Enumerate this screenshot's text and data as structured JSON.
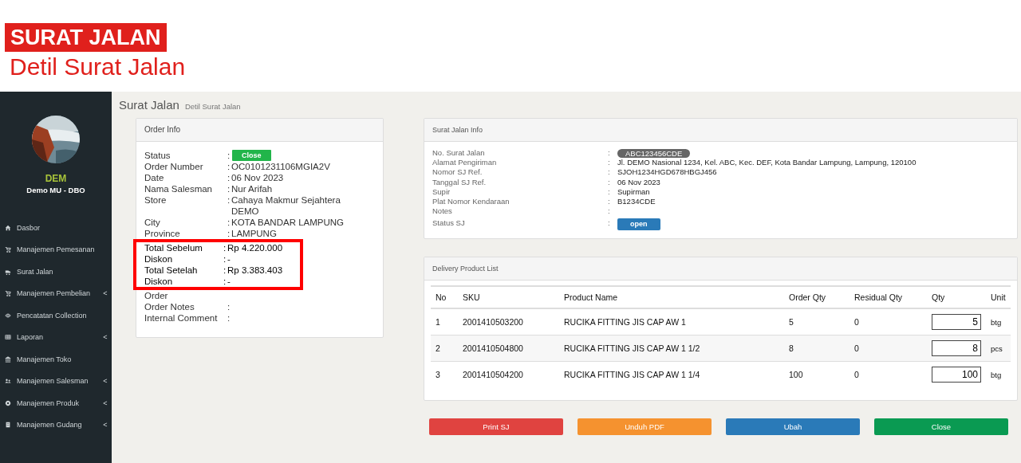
{
  "banner": {
    "title": "SURAT JALAN",
    "subtitle": "Detil Surat Jalan"
  },
  "sidebar": {
    "user": {
      "initials": "DEM",
      "name": "Demo MU - DBO"
    },
    "items": [
      {
        "label": "Dasbor",
        "kind": "home"
      },
      {
        "label": "Manajemen Pemesanan",
        "kind": "cart"
      },
      {
        "label": "Surat Jalan",
        "kind": "truck"
      },
      {
        "label": "Manajemen Pembelian",
        "kind": "cart",
        "chevron": "<"
      },
      {
        "label": "Pencatatan Collection",
        "kind": "eye"
      },
      {
        "label": "Laporan",
        "kind": "table",
        "chevron": "<"
      },
      {
        "label": "Manajemen Toko",
        "kind": "bank"
      },
      {
        "label": "Manajemen Salesman",
        "kind": "users",
        "chevron": "<"
      },
      {
        "label": "Manajemen Produk",
        "kind": "gear",
        "chevron": "<"
      },
      {
        "label": "Manajemen Gudang",
        "kind": "building",
        "chevron": "<"
      }
    ]
  },
  "page": {
    "title": "Surat Jalan",
    "subtitle": "Detil Surat Jalan"
  },
  "order_info": {
    "title": "Order Info",
    "rows": [
      {
        "label": "Status",
        "sep": ":",
        "badge": "Close"
      },
      {
        "label": "Order Number",
        "sep": ":",
        "value": "OC0101231106MGIA2V"
      },
      {
        "label": "Date",
        "sep": ":",
        "value": "06 Nov 2023"
      },
      {
        "label": "Nama Salesman",
        "sep": ":",
        "value": "Nur Arifah"
      },
      {
        "label": "Store",
        "sep": ":",
        "value": "Cahaya Makmur Sejahtera DEMO"
      },
      {
        "label": "City",
        "sep": ":",
        "value": "KOTA BANDAR LAMPUNG"
      },
      {
        "label": "Province",
        "sep": ":",
        "value": "LAMPUNG"
      }
    ],
    "highlight_rows": [
      {
        "label": "Total Sebelum",
        "sep": ":",
        "value": "Rp 4.220.000"
      },
      {
        "label": "Diskon",
        "sep": ":",
        "value": "-"
      },
      {
        "label": "Total Setelah",
        "sep": ":",
        "value": "Rp 3.383.403"
      },
      {
        "label": "Diskon",
        "sep": ":",
        "value": "-"
      }
    ],
    "after_rows": [
      {
        "label": "Order"
      },
      {
        "label": "Order Notes",
        "sep": ":"
      },
      {
        "label": "Internal Comment",
        "sep": ":"
      }
    ]
  },
  "sj_info": {
    "title": "Surat Jalan Info",
    "rows": [
      {
        "label": "No. Surat Jalan",
        "sep": ":",
        "pill": "ABC123456CDE"
      },
      {
        "label": "Alamat Pengiriman",
        "sep": ":",
        "value": "Jl. DEMO Nasional 1234, Kel. ABC, Kec. DEF, Kota Bandar Lampung, Lampung, 120100"
      },
      {
        "label": "Nomor SJ Ref.",
        "sep": ":",
        "value": "SJOH1234HGD678HBGJ456"
      },
      {
        "label": "Tanggal SJ Ref.",
        "sep": ":",
        "value": "06 Nov 2023"
      },
      {
        "label": "Supir",
        "sep": ":",
        "value": "Supirman"
      },
      {
        "label": "Plat Nomor Kendaraan",
        "sep": ":",
        "value": "B1234CDE"
      },
      {
        "label": "Notes",
        "sep": ":"
      },
      {
        "label": "Status SJ",
        "sep": ":",
        "badge": "open"
      }
    ]
  },
  "delivery": {
    "title": "Delivery Product List",
    "columns": [
      "No",
      "SKU",
      "Product Name",
      "Order Qty",
      "Residual Qty",
      "Qty",
      "Unit"
    ],
    "rows": [
      {
        "no": "1",
        "sku": "2001410503200",
        "name": "RUCIKA FITTING JIS CAP AW 1",
        "order_qty": "5",
        "residual_qty": "0",
        "qty": "5",
        "unit": "btg"
      },
      {
        "no": "2",
        "sku": "2001410504800",
        "name": "RUCIKA FITTING JIS CAP AW 1 1/2",
        "order_qty": "8",
        "residual_qty": "0",
        "qty": "8",
        "unit": "pcs"
      },
      {
        "no": "3",
        "sku": "2001410504200",
        "name": "RUCIKA FITTING JIS CAP AW 1 1/4",
        "order_qty": "100",
        "residual_qty": "0",
        "qty": "100",
        "unit": "btg"
      }
    ]
  },
  "buttons": [
    {
      "label": "Print SJ",
      "color": "#e04340"
    },
    {
      "label": "Unduh PDF",
      "color": "#f5922f"
    },
    {
      "label": "Ubah",
      "color": "#2a7ab8"
    },
    {
      "label": "Close",
      "color": "#0a9a52"
    }
  ]
}
